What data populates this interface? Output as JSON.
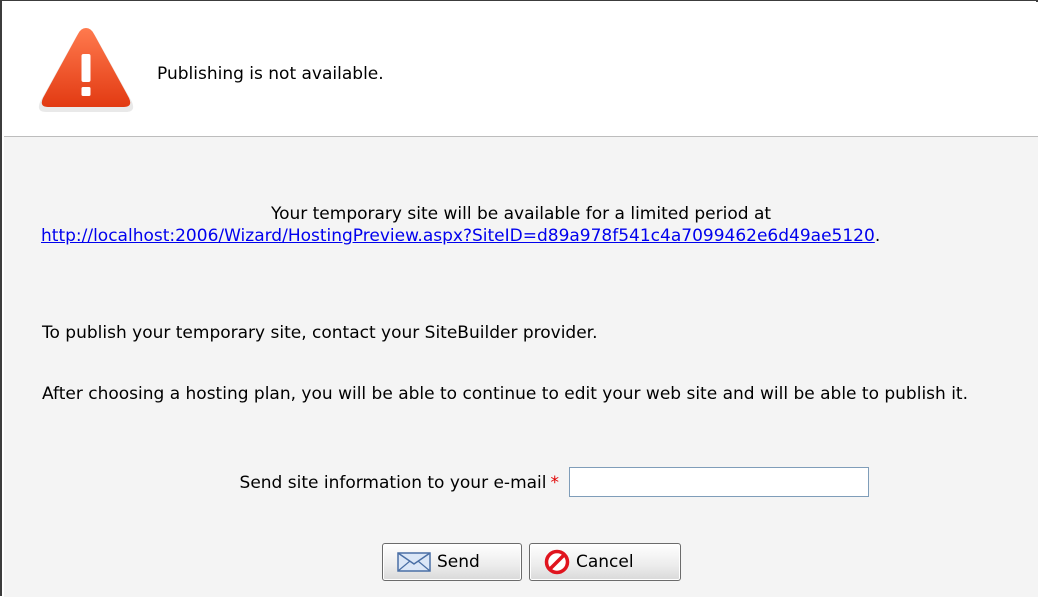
{
  "header": {
    "icon": "warning-icon",
    "title": "Publishing is not available."
  },
  "message": {
    "temp_line": "Your temporary site will be available for a limited period at",
    "temp_url": "http://localhost:2006/Wizard/HostingPreview.aspx?SiteID=d89a978f541c4a7099462e6d49ae5120",
    "temp_url_suffix": ".",
    "contact": "To publish your temporary site, contact your SiteBuilder provider.",
    "after": "After choosing a hosting plan, you will be able to continue to edit your web site and will be able to publish it."
  },
  "form": {
    "email_label": "Send site information to your e-mail",
    "required_marker": "*",
    "email_value": ""
  },
  "buttons": {
    "send_label": "Send",
    "send_icon": "envelope-icon",
    "cancel_label": "Cancel",
    "cancel_icon": "prohibited-icon"
  },
  "colors": {
    "warning": "#e8401c",
    "link": "#0000ee",
    "required": "#e00000"
  }
}
